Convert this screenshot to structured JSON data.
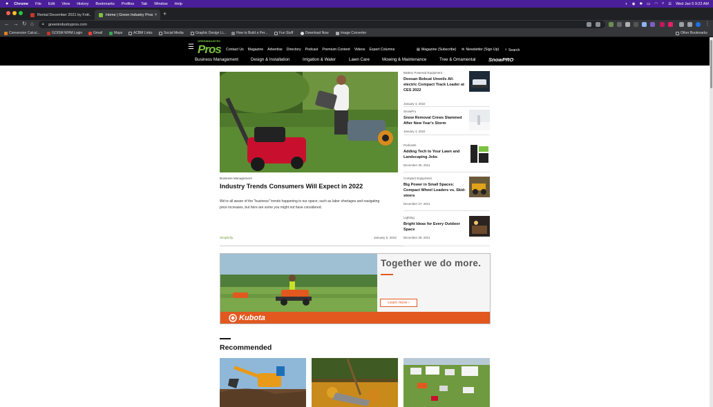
{
  "menubar": {
    "app": "Chrome",
    "items": [
      "File",
      "Edit",
      "View",
      "History",
      "Bookmarks",
      "Profiles",
      "Tab",
      "Window",
      "Help"
    ],
    "clock": "Wed Jan 5  9:22 AM"
  },
  "tabs": [
    {
      "label": "Rental December 2021 by For...",
      "active": false
    },
    {
      "label": "Home | Green Industry Pros",
      "active": true
    }
  ],
  "address": {
    "url": "greenindustrypros.com"
  },
  "bookmarks": [
    "Conversion Calcul...",
    "GOISM WHM Login",
    "Gmail",
    "Maps",
    "ACBM Links",
    "Social Media",
    "Graphic Design Li...",
    "How to Build a Per...",
    "Fun Stuff",
    "Download Now",
    "Image Converter"
  ],
  "other_bookmarks": "Other Bookmarks",
  "site": {
    "logo_line1": "GREEN",
    "logo_line2": "INDUSTRY",
    "logo_main": "Pros",
    "top_nav": [
      "Contact Us",
      "Magazine",
      "Advertise",
      "Directory",
      "Podcast",
      "Premium Content",
      "Videos",
      "Expert Columns"
    ],
    "magazine_subscribe": "Magazine (Subscribe)",
    "newsletter_signup": "Newsletter (Sign Up)",
    "search": "Search",
    "main_nav": [
      "Business Management",
      "Design & Installation",
      "Irrigation & Water",
      "Lawn Care",
      "Mowing & Maintenance",
      "Tree & Ornamental"
    ],
    "snowpro_logo": "SnowPRO"
  },
  "hero": {
    "category": "Business Management",
    "title": "Industry Trends Consumers Will Expect in 2022",
    "excerpt": "We're all aware of the \"business\" trends happening in our space; such as labor shortages and navigating price increases, but here are some you might not have considered.",
    "tag": "Simplicity",
    "date": "January 5, 2022"
  },
  "sidebar": [
    {
      "category": "Battery Powered Equipment",
      "title": "Doosan Bobcat Unveils All-electric Compact Track Loader at CES 2022",
      "date": "January 4, 2022"
    },
    {
      "category": "SnowPro",
      "title": "Snow Removal Crews Slammed After New Year's Storm",
      "date": "January 4, 2022"
    },
    {
      "category": "Podcasts",
      "title": "Adding Tech to Your Lawn and Landscaping Jobs",
      "date": "December 30, 2021"
    },
    {
      "category": "Compact Equipment",
      "title": "Big Power in Small Spaces: Compact Wheel Loaders vs. Skid-steers",
      "date": "December 27, 2021"
    },
    {
      "category": "Lighting",
      "title": "Bright Ideas for Every Outdoor Space",
      "date": "December 28, 2021"
    }
  ],
  "ad": {
    "headline": "Together we do more.",
    "cta": "Learn more ›",
    "brand": "Kubota"
  },
  "recommended": {
    "heading": "Recommended"
  },
  "colors": {
    "accent_green": "#7cc242",
    "kubota_orange": "#e2581f",
    "menubar_purple": "#4b1f9a"
  }
}
